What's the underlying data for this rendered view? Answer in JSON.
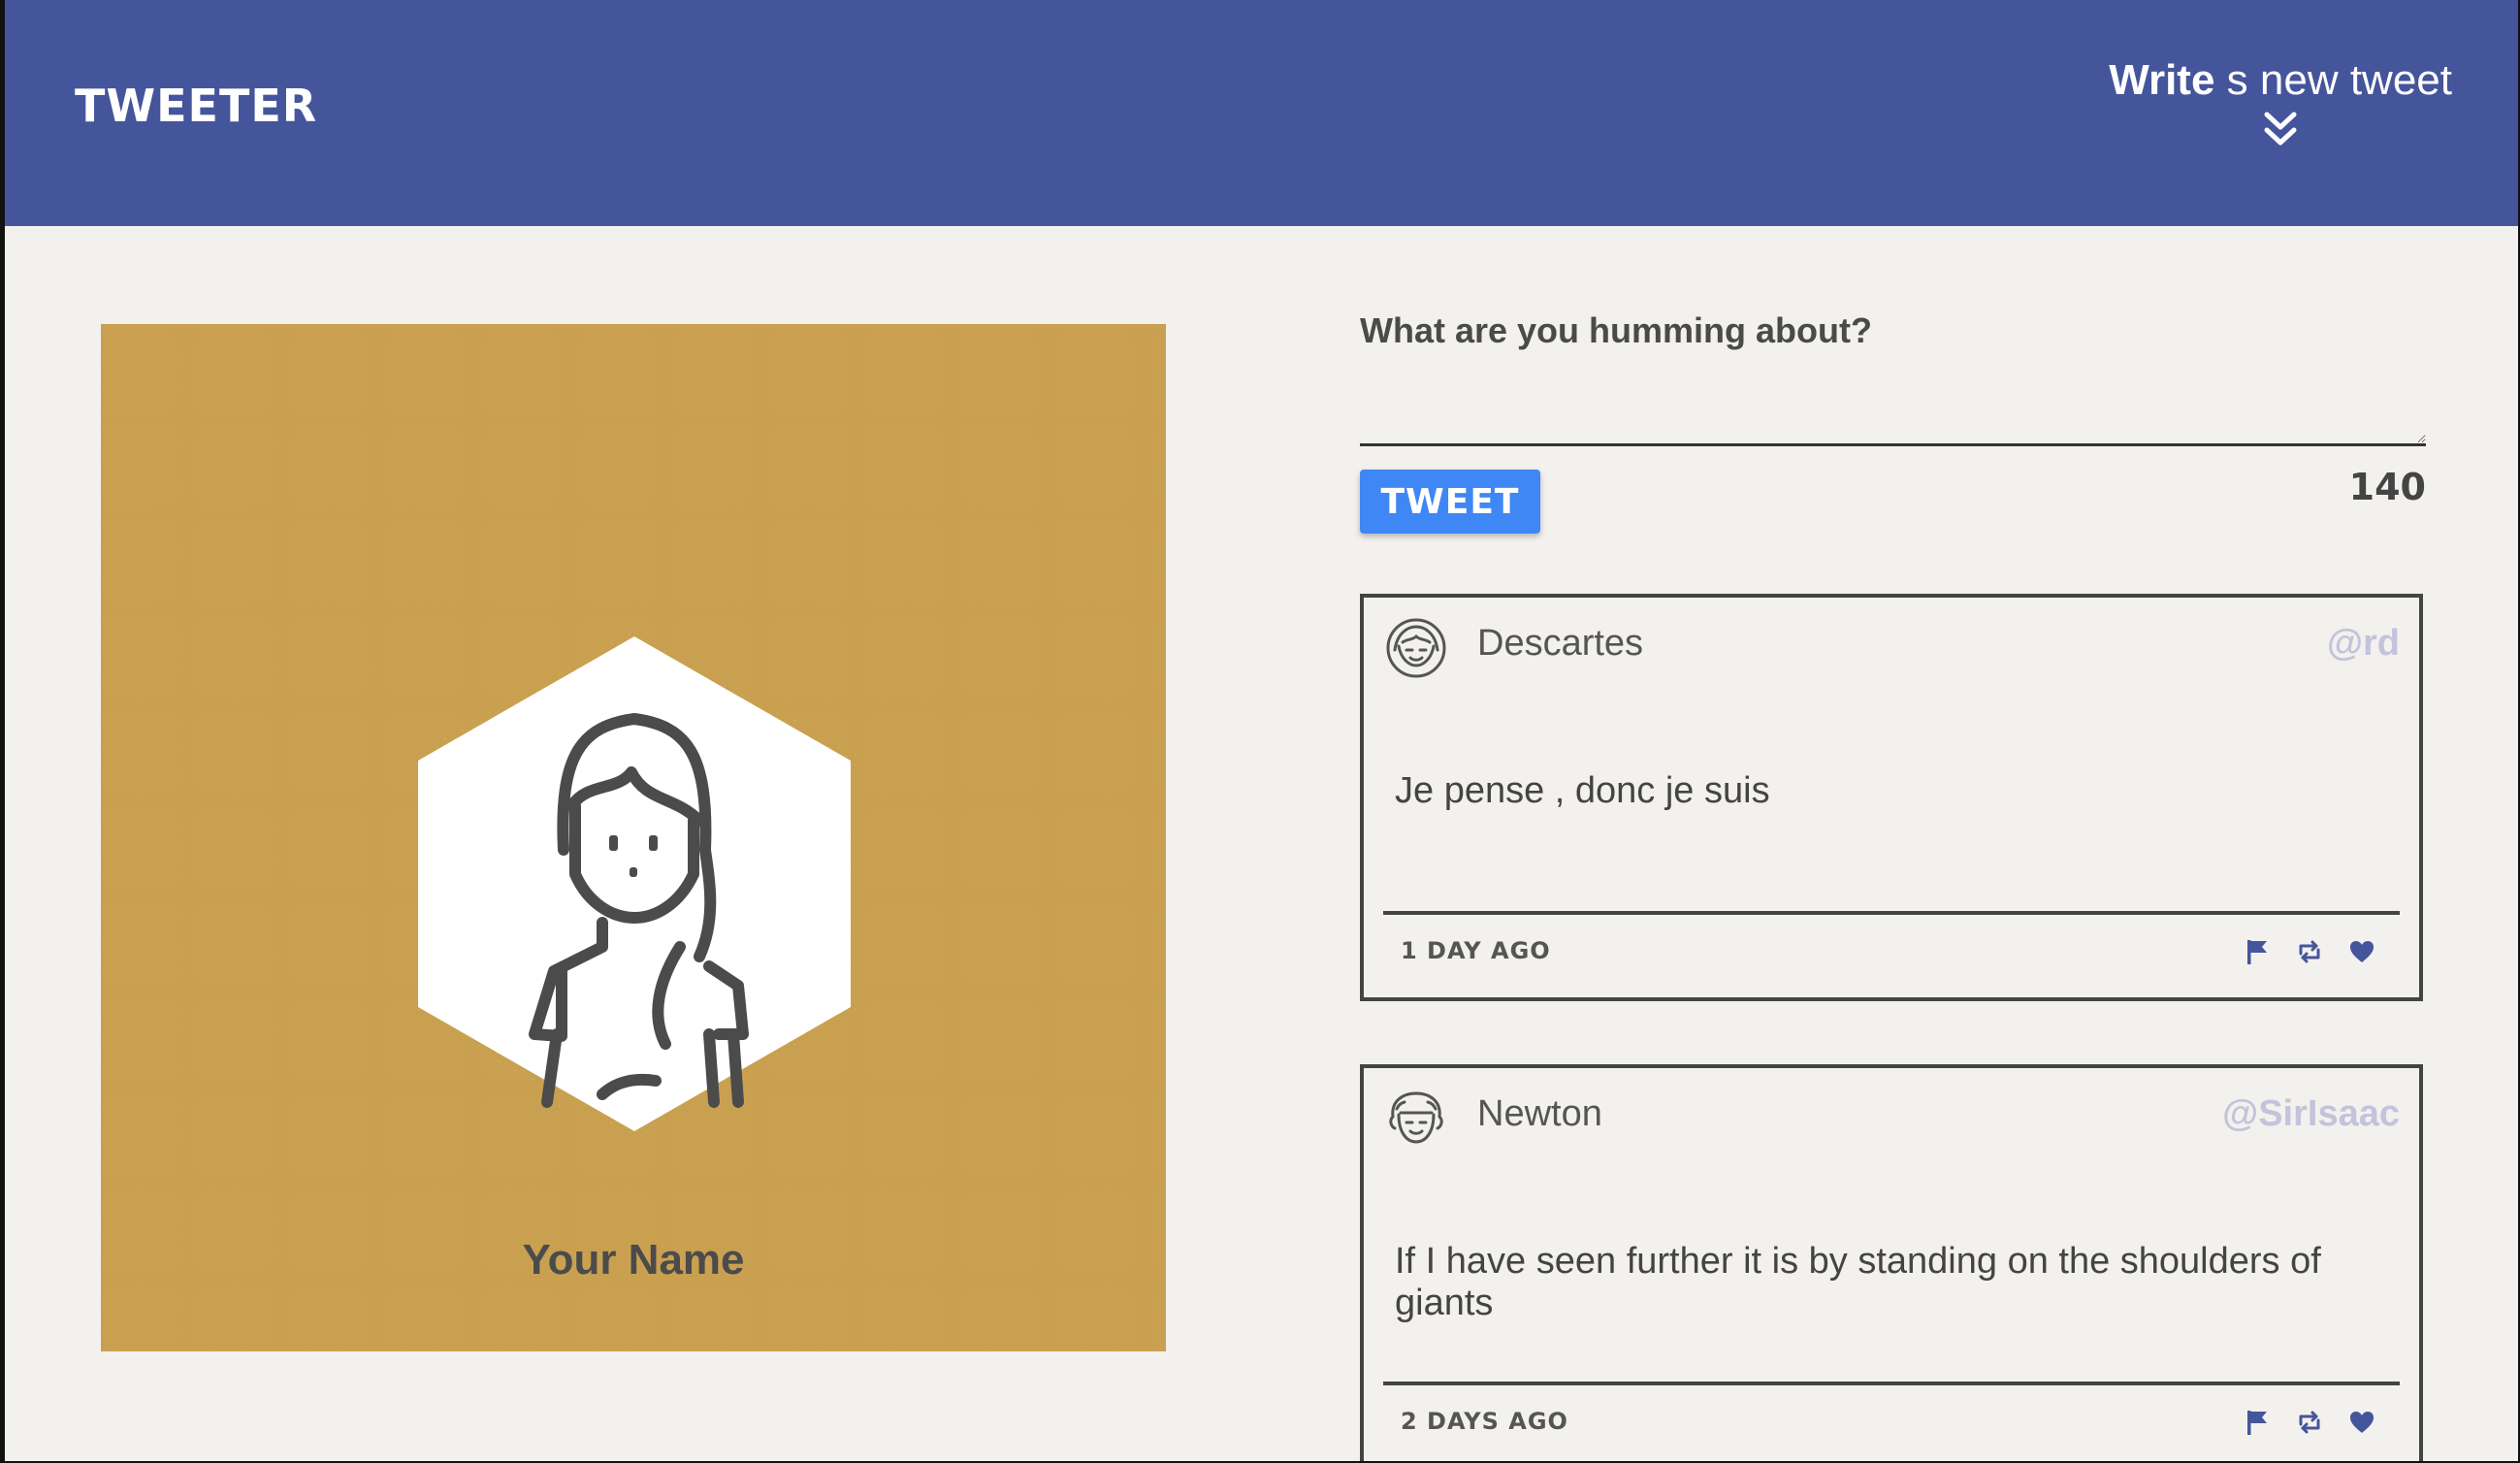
{
  "header": {
    "brand": "TWEETER",
    "compose_toggle_bold": "Write",
    "compose_toggle_rest": " s new tweet"
  },
  "profile": {
    "name": "Your Name"
  },
  "composer": {
    "label": "What are you humming about?",
    "value": "",
    "placeholder": "",
    "button_label": "TWEET",
    "char_count": "140"
  },
  "tweets": [
    {
      "name": "Descartes",
      "handle": "@rd",
      "text": "Je pense , donc je suis",
      "age": "1 day ago"
    },
    {
      "name": "Newton",
      "handle": "@SirIsaac",
      "text": "If I have seen further it is by standing on the shoulders of giants",
      "age": "2 days ago"
    }
  ],
  "colors": {
    "nav_bg": "#45559b",
    "profile_bg": "#c9a04f",
    "tweet_button": "#3f87f5",
    "handle": "#c3c3dc",
    "icon": "#45559b"
  },
  "icons": [
    "chevrons-down-icon",
    "user-hexagon-avatar",
    "flag-icon",
    "retweet-icon",
    "heart-icon"
  ]
}
